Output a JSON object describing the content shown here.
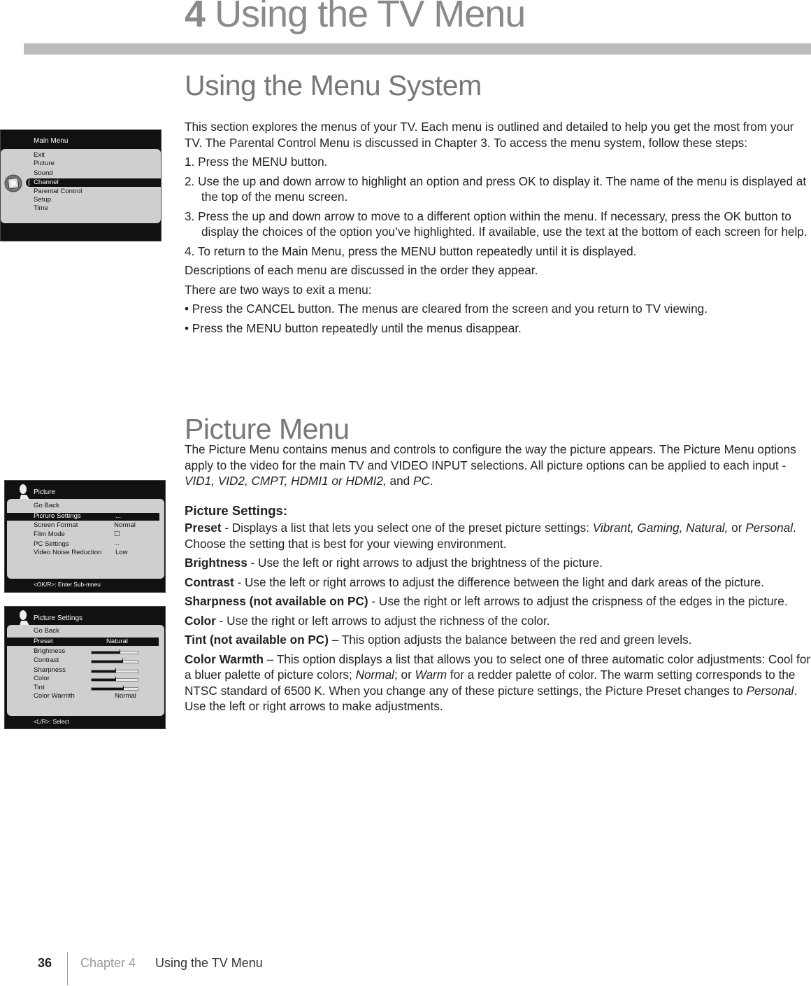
{
  "header": {
    "chapter_number": "4",
    "chapter_title": "Using the TV Menu"
  },
  "section_menu_system": {
    "heading": "Using the Menu System",
    "intro": "This section explores the menus of your TV. Each menu is outlined and detailed to help you get the most from your TV. The Parental Control Menu is discussed in Chapter 3. To access the menu system, follow these steps:",
    "steps": [
      "1. Press the MENU button.",
      "2. Use the up and down arrow to highlight an option and press OK to display it. The name of the menu is displayed at the top of the menu screen.",
      "3. Press the up and down arrow to move to a different option within the menu. If necessary, press the OK button to display the choices of the option you’ve highlighted. If available, use the text at the bottom of each screen for help.",
      "4. To return to the Main Menu, press the MENU button repeatedly until it is displayed."
    ],
    "descriptions_note": "Descriptions of each menu are discussed in the order they appear.",
    "exit_intro": "There are two ways to exit a menu:",
    "exit_bullets": [
      "• Press the CANCEL button. The menus are cleared from the screen and you return to TV viewing.",
      "• Press the MENU button repeatedly until the menus disappear."
    ]
  },
  "section_picture_menu": {
    "heading": "Picture Menu",
    "intro_plain": "The Picture Menu contains menus and controls to configure the way the picture appears. The Picture Menu options apply to the video for the main TV and VIDEO INPUT selections. All picture options can be applied to each input - ",
    "intro_inputs": "VID1, VID2, CMPT, HDMI1 or HDMI2,",
    "intro_and": " and ",
    "intro_pc": "PC",
    "intro_end": ".",
    "settings_heading": "Picture Settings:",
    "preset": {
      "label": "Preset",
      "text_a": " -  Displays a list that lets you select one of the preset picture settings: ",
      "options_italic": "Vibrant, Gaming, Natural,",
      "text_or": " or ",
      "personal": "Personal",
      "text_b": ".  Choose the setting that is best for your viewing environment."
    },
    "brightness": {
      "label": "Brightness",
      "text": " -  Use the left or right arrows to adjust the brightness of the picture."
    },
    "contrast": {
      "label": "Contrast",
      "text": " - Use the left or right arrows to adjust the difference between the light and dark areas of the picture."
    },
    "sharpness": {
      "label": "Sharpness (not available on PC)",
      "text": " - Use the right or left arrows to adjust the crispness of the edges in the picture."
    },
    "color": {
      "label": "Color",
      "text": " - Use the right or left arrows to adjust the richness of the color."
    },
    "tint": {
      "label": "Tint (not available on PC)",
      "text": " – This option adjusts the balance between the red and green levels."
    },
    "color_warmth": {
      "label": "Color Warmth",
      "text_a": " – This option displays a list that allows you to select one of three automatic color adjustments: Cool for a bluer palette of picture colors; ",
      "normal": "Normal",
      "text_b": "; or ",
      "warm": "Warm",
      "text_c": " for a redder palette of color. The warm setting corresponds to the NTSC standard of 6500 K. When you change any of these picture settings, the Picture Preset changes to ",
      "personal": "Personal",
      "text_d": ". Use the left or right arrows to make adjustments."
    }
  },
  "tv_main_menu": {
    "title": "Main Menu",
    "items": [
      "Exit",
      "Picture",
      "Sound",
      "Channel",
      "Parental Control",
      "Setup",
      "Time"
    ],
    "selected": "Channel",
    "cursor_glyph": "("
  },
  "tv_picture_menu": {
    "title": "Picture",
    "go_back": "Go Back",
    "rows": [
      {
        "label": "Picrure Settings",
        "value": "...",
        "selected": true
      },
      {
        "label": "Screen Format",
        "value": "Normal"
      },
      {
        "label": "Film Mode",
        "value": "☐"
      },
      {
        "label": "PC Settings",
        "value": "..."
      },
      {
        "label": "Video Noise Reduction",
        "value": "Low"
      }
    ],
    "footer": "<OK/R>: Enter Sub-mneu"
  },
  "tv_picture_settings": {
    "title": "Picture Settings",
    "go_back": "Go Back",
    "preset_label": "Preset",
    "preset_value": "Natural",
    "sliders": [
      {
        "label": "Brightness",
        "percent": 61
      },
      {
        "label": "Contrast",
        "percent": 66
      },
      {
        "label": "Sharpness",
        "percent": 51
      },
      {
        "label": "Color",
        "percent": 51
      },
      {
        "label": "Tint",
        "percent": 68
      }
    ],
    "warmth_label": "Color Warmth",
    "warmth_value": "Normal",
    "footer": "<L/R>: Select"
  },
  "footer": {
    "page_number": "36",
    "chapter": "Chapter 4",
    "title": "Using the TV Menu"
  }
}
